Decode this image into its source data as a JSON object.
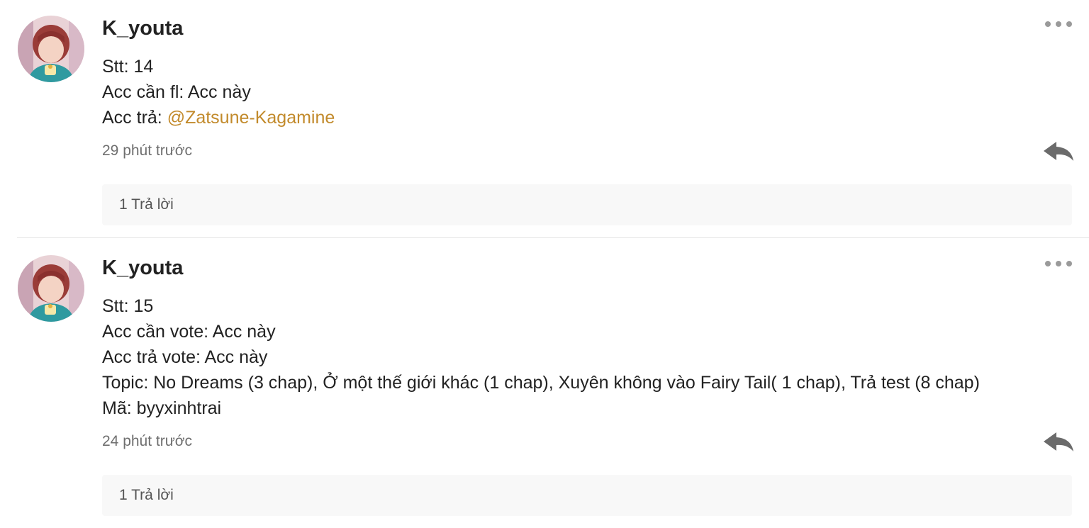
{
  "comments": [
    {
      "author": "K_youta",
      "lines": [
        {
          "text": "Stt: 14"
        },
        {
          "text": "Acc cần fl: Acc này"
        },
        {
          "prefix": "Acc trả: ",
          "mention": "@Zatsune-Kagamine"
        }
      ],
      "time": "29 phút trước",
      "replies_label": "1 Trả lời"
    },
    {
      "author": "K_youta",
      "lines": [
        {
          "text": "Stt: 15"
        },
        {
          "text": "Acc cần vote: Acc này"
        },
        {
          "text": "Acc trả vote: Acc này"
        },
        {
          "text": "Topic: No Dreams (3 chap), Ở một thế giới khác (1 chap), Xuyên không vào Fairy Tail( 1 chap), Trả test (8 chap)"
        },
        {
          "text": "Mã: byyxinhtrai"
        }
      ],
      "time": "24 phút trước",
      "replies_label": "1 Trả lời"
    }
  ],
  "icons": {
    "more": "more-options-icon",
    "reply": "reply-arrow-icon",
    "avatar": "user-avatar"
  },
  "colors": {
    "mention": "#c28a2b",
    "muted_text": "#6f6f6f",
    "icon_gray": "#6b6b6b",
    "replies_bg": "#f8f8f8"
  }
}
